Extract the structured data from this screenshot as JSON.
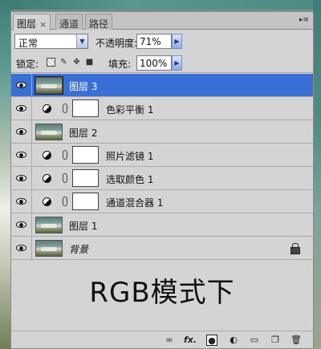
{
  "tabs": [
    {
      "label": "图层",
      "close": "×",
      "active": true
    },
    {
      "label": "通道",
      "active": false
    },
    {
      "label": "路径",
      "active": false
    }
  ],
  "panel_menu_icon": "menu-arrow-icon",
  "controls": {
    "blend_mode": "正常",
    "opacity_label": "不透明度:",
    "opacity_value": "71%",
    "lock_label": "锁定:",
    "fill_label": "填充:",
    "fill_value": "100%"
  },
  "layers": [
    {
      "name": "图层 3",
      "kind": "image",
      "selected": true
    },
    {
      "name": "色彩平衡 1",
      "kind": "adjustment",
      "selected": false
    },
    {
      "name": "图层 2",
      "kind": "image",
      "selected": false
    },
    {
      "name": "照片滤镜 1",
      "kind": "adjustment",
      "selected": false
    },
    {
      "name": "选取颜色 1",
      "kind": "adjustment",
      "selected": false
    },
    {
      "name": "通道混合器 1",
      "kind": "adjustment",
      "selected": false
    },
    {
      "name": "图层 1",
      "kind": "image",
      "selected": false
    },
    {
      "name": "背景",
      "kind": "background",
      "selected": false,
      "locked": true
    }
  ],
  "caption": "RGB模式下",
  "bottom_bar": {
    "fx_label": "fx.",
    "icons": [
      "link-layers-icon",
      "fx-icon",
      "add-mask-icon",
      "new-adjustment-icon",
      "new-group-icon",
      "new-layer-icon",
      "delete-layer-icon"
    ]
  }
}
